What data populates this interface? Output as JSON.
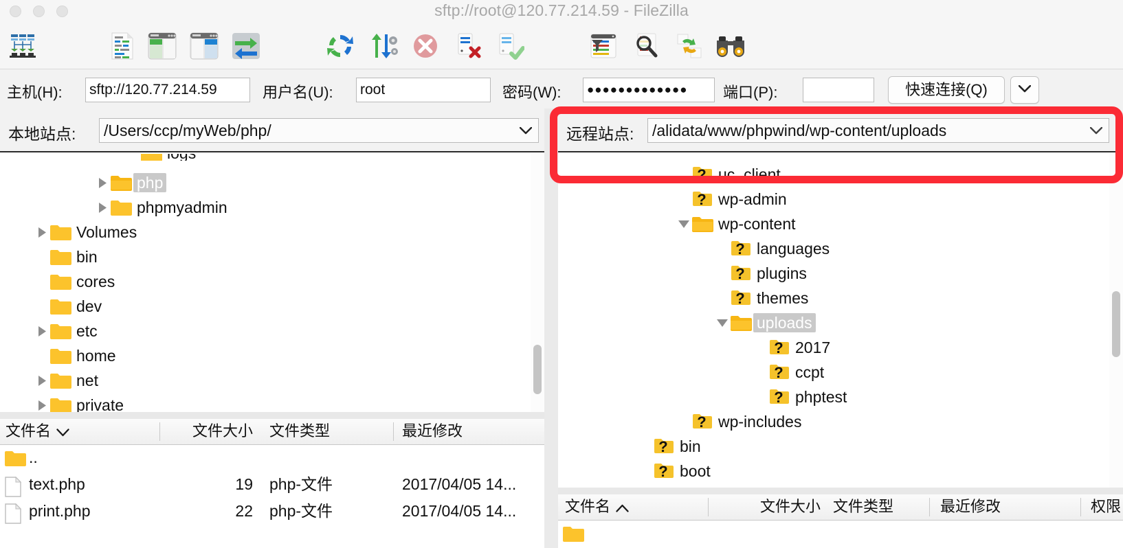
{
  "window": {
    "title": "sftp://root@120.77.214.59 - FileZilla",
    "traffic_lights": [
      "close",
      "minimize",
      "zoom"
    ]
  },
  "toolbar": {
    "items": [
      {
        "name": "site-manager-icon",
        "tooltip": "站点管理器"
      },
      {
        "name": "toggle-message-log-icon",
        "tooltip": "切换消息日志显示"
      },
      {
        "name": "toggle-local-tree-icon",
        "tooltip": "切换本地目录树显示"
      },
      {
        "name": "toggle-remote-tree-icon",
        "tooltip": "切换远程目录树显示"
      },
      {
        "name": "toggle-transfer-queue-icon",
        "tooltip": "切换传输队列显示"
      },
      {
        "name": "refresh-icon",
        "tooltip": "刷新文件和文件夹列表"
      },
      {
        "name": "process-queue-icon",
        "tooltip": "处理队列"
      },
      {
        "name": "cancel-icon",
        "tooltip": "取消当前操作"
      },
      {
        "name": "disconnect-icon",
        "tooltip": "断开当前所显示的服务器"
      },
      {
        "name": "reconnect-icon",
        "tooltip": "重新连接上次使用的服务器"
      },
      {
        "name": "filter-icon",
        "tooltip": "文件名过滤器"
      },
      {
        "name": "search-remote-files-icon",
        "tooltip": "搜索远程文件"
      },
      {
        "name": "synchronized-browsing-icon",
        "tooltip": "同步浏览"
      },
      {
        "name": "directory-comparison-icon",
        "tooltip": "目录比较"
      }
    ]
  },
  "connection_bar": {
    "host_label": "主机(H):",
    "host_value": "sftp://120.77.214.59",
    "user_label": "用户名(U):",
    "user_value": "root",
    "password_label": "密码(W):",
    "password_value": "●●●●●●●●●●●●●",
    "port_label": "端口(P):",
    "port_value": "",
    "quickconnect_label": "快速连接(Q)",
    "quickconnect_dropdown_icon": "chevron-down-icon"
  },
  "local": {
    "site_label": "本地站点:",
    "site_path": "/Users/ccp/myWeb/php/",
    "combo_icon": "chevron-down-icon",
    "tree": [
      {
        "label": "logs",
        "indent": 4,
        "expander": "none",
        "selected": false,
        "icon": "folder-icon",
        "partial": true
      },
      {
        "label": "php",
        "indent": 3,
        "expander": "collapsed",
        "selected": true,
        "icon": "folder-open-icon"
      },
      {
        "label": "phpmyadmin",
        "indent": 3,
        "expander": "collapsed",
        "selected": false,
        "icon": "folder-icon"
      },
      {
        "label": "Volumes",
        "indent": 1,
        "expander": "collapsed",
        "selected": false,
        "icon": "folder-icon"
      },
      {
        "label": "bin",
        "indent": 1,
        "expander": "none",
        "selected": false,
        "icon": "folder-icon"
      },
      {
        "label": "cores",
        "indent": 1,
        "expander": "none",
        "selected": false,
        "icon": "folder-icon"
      },
      {
        "label": "dev",
        "indent": 1,
        "expander": "none",
        "selected": false,
        "icon": "folder-icon"
      },
      {
        "label": "etc",
        "indent": 1,
        "expander": "collapsed",
        "selected": false,
        "icon": "folder-icon"
      },
      {
        "label": "home",
        "indent": 1,
        "expander": "none",
        "selected": false,
        "icon": "folder-icon"
      },
      {
        "label": "net",
        "indent": 1,
        "expander": "collapsed",
        "selected": false,
        "icon": "folder-icon"
      },
      {
        "label": "private",
        "indent": 1,
        "expander": "collapsed",
        "selected": false,
        "icon": "folder-icon"
      }
    ],
    "filelist": {
      "columns": [
        {
          "label": "文件名",
          "sort": "desc"
        },
        {
          "label": "文件大小",
          "sort": "none"
        },
        {
          "label": "文件类型",
          "sort": "none"
        },
        {
          "label": "最近修改",
          "sort": "none"
        }
      ],
      "rows": [
        {
          "icon": "folder-icon",
          "name": "..",
          "size": "",
          "type": "",
          "modified": ""
        },
        {
          "icon": "file-icon",
          "name": "text.php",
          "size": "19",
          "type": "php-文件",
          "modified": "2017/04/05 14..."
        },
        {
          "icon": "file-icon",
          "name": "print.php",
          "size": "22",
          "type": "php-文件",
          "modified": "2017/04/05 14..."
        }
      ]
    }
  },
  "remote": {
    "site_label": "远程站点:",
    "site_path": "/alidata/www/phpwind/wp-content/uploads",
    "combo_icon": "chevron-down-icon",
    "tree": [
      {
        "label": "uc_client",
        "indent": 2,
        "expander": "none",
        "selected": false,
        "icon": "folder-unknown-icon"
      },
      {
        "label": "wp-admin",
        "indent": 2,
        "expander": "none",
        "selected": false,
        "icon": "folder-unknown-icon"
      },
      {
        "label": "wp-content",
        "indent": 2,
        "expander": "expanded",
        "selected": false,
        "icon": "folder-open-icon"
      },
      {
        "label": "languages",
        "indent": 3,
        "expander": "none",
        "selected": false,
        "icon": "folder-unknown-icon"
      },
      {
        "label": "plugins",
        "indent": 3,
        "expander": "none",
        "selected": false,
        "icon": "folder-unknown-icon"
      },
      {
        "label": "themes",
        "indent": 3,
        "expander": "none",
        "selected": false,
        "icon": "folder-unknown-icon"
      },
      {
        "label": "uploads",
        "indent": 3,
        "expander": "expanded",
        "selected": true,
        "icon": "folder-open-icon"
      },
      {
        "label": "2017",
        "indent": 4,
        "expander": "none",
        "selected": false,
        "icon": "folder-unknown-icon"
      },
      {
        "label": "ccpt",
        "indent": 4,
        "expander": "none",
        "selected": false,
        "icon": "folder-unknown-icon"
      },
      {
        "label": "phptest",
        "indent": 4,
        "expander": "none",
        "selected": false,
        "icon": "folder-unknown-icon"
      },
      {
        "label": "wp-includes",
        "indent": 2,
        "expander": "none",
        "selected": false,
        "icon": "folder-unknown-icon"
      },
      {
        "label": "bin",
        "indent": 1,
        "expander": "none",
        "selected": false,
        "icon": "folder-unknown-icon"
      },
      {
        "label": "boot",
        "indent": 1,
        "expander": "none",
        "selected": false,
        "icon": "folder-unknown-icon"
      }
    ],
    "filelist": {
      "columns": [
        {
          "label": "文件名",
          "sort": "asc"
        },
        {
          "label": "文件大小",
          "sort": "none"
        },
        {
          "label": "文件类型",
          "sort": "none"
        },
        {
          "label": "最近修改",
          "sort": "none"
        },
        {
          "label": "权限",
          "sort": "none"
        }
      ],
      "rows": [
        {
          "icon": "folder-icon",
          "name": "",
          "size": "",
          "type": "",
          "modified": "",
          "perms": ""
        }
      ]
    }
  },
  "annotation": {
    "highlight_color": "#fb2b35",
    "target": "remote-site-path-field"
  },
  "colors": {
    "folder_yellow": "#fcc32c",
    "folder_yellow_dark": "#f5b315",
    "selection_gray": "#c9c9c9",
    "accent_red": "#fb2b35",
    "green": "#47b14b",
    "blue": "#1e82d2",
    "title_gray": "#a8a8a8"
  }
}
